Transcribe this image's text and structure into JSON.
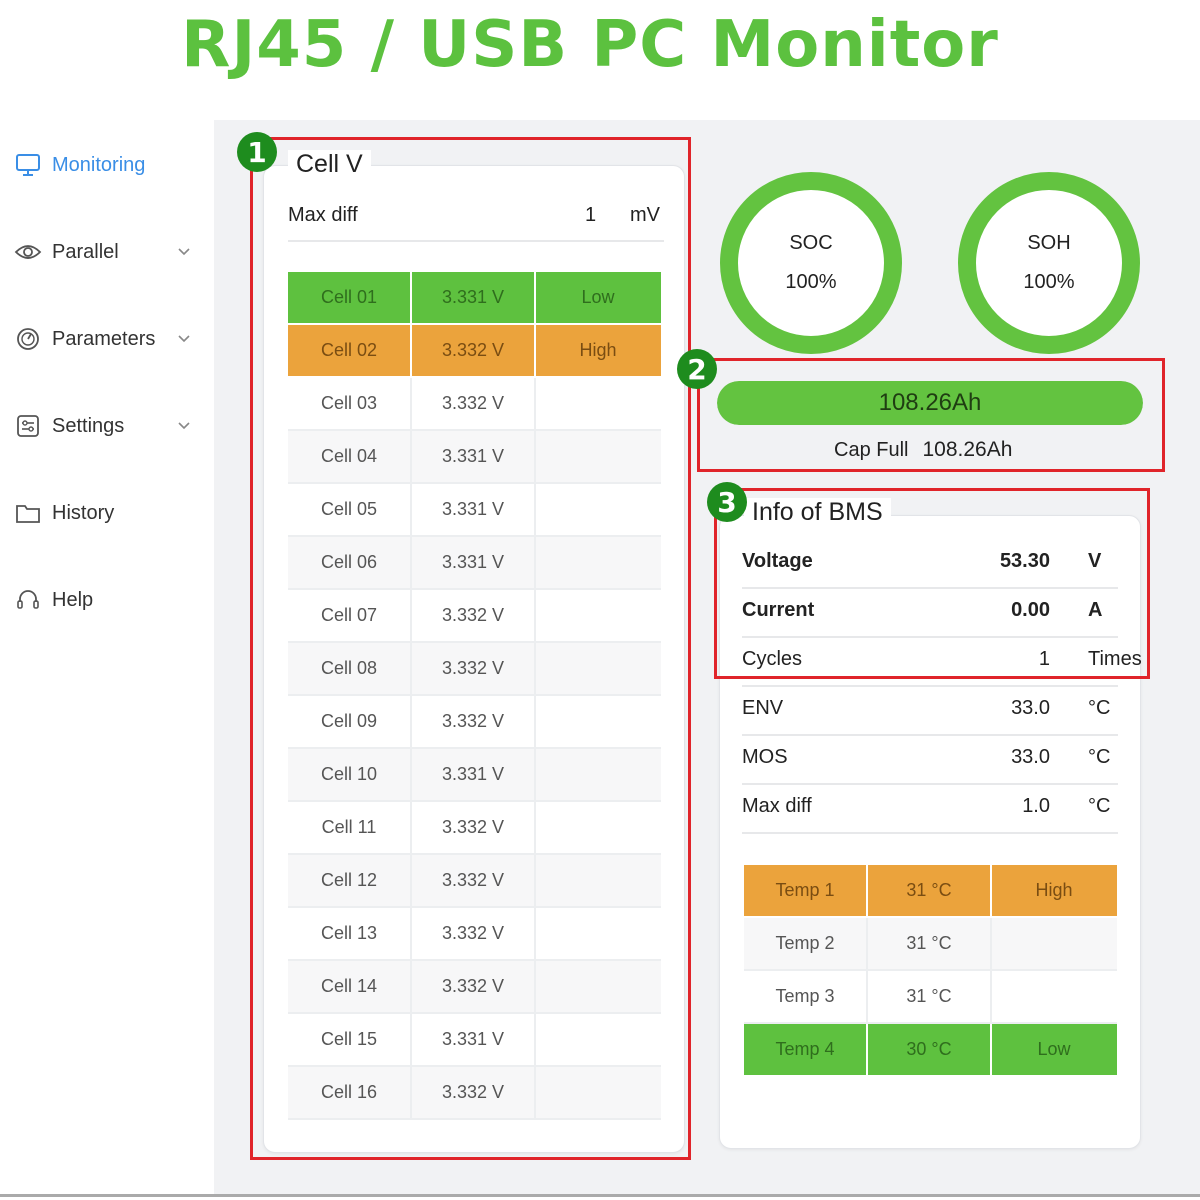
{
  "headline": "RJ45 / USB PC Monitor",
  "colors": {
    "accent_green": "#63c340",
    "warn_orange": "#eba33c",
    "active_blue": "#3a8ee6",
    "annotation_red": "#e0242a"
  },
  "sidebar": {
    "items": [
      {
        "label": "Monitoring",
        "icon": "monitor-icon",
        "active": true,
        "expandable": false
      },
      {
        "label": "Parallel",
        "icon": "eye-icon",
        "active": false,
        "expandable": true
      },
      {
        "label": "Parameters",
        "icon": "gauge-icon",
        "active": false,
        "expandable": true
      },
      {
        "label": "Settings",
        "icon": "sliders-icon",
        "active": false,
        "expandable": true
      },
      {
        "label": "History",
        "icon": "folder-icon",
        "active": false,
        "expandable": false
      },
      {
        "label": "Help",
        "icon": "headset-icon",
        "active": false,
        "expandable": false
      }
    ]
  },
  "cell_card": {
    "title": "Cell V",
    "max_diff": {
      "label": "Max diff",
      "value": "1",
      "unit": "mV"
    },
    "rows": [
      {
        "name": "Cell 01",
        "voltage": "3.331 V",
        "flag": "Low"
      },
      {
        "name": "Cell 02",
        "voltage": "3.332 V",
        "flag": "High"
      },
      {
        "name": "Cell 03",
        "voltage": "3.332 V",
        "flag": ""
      },
      {
        "name": "Cell 04",
        "voltage": "3.331 V",
        "flag": ""
      },
      {
        "name": "Cell 05",
        "voltage": "3.331 V",
        "flag": ""
      },
      {
        "name": "Cell 06",
        "voltage": "3.331 V",
        "flag": ""
      },
      {
        "name": "Cell 07",
        "voltage": "3.332 V",
        "flag": ""
      },
      {
        "name": "Cell 08",
        "voltage": "3.332 V",
        "flag": ""
      },
      {
        "name": "Cell 09",
        "voltage": "3.332 V",
        "flag": ""
      },
      {
        "name": "Cell 10",
        "voltage": "3.331 V",
        "flag": ""
      },
      {
        "name": "Cell 11",
        "voltage": "3.332 V",
        "flag": ""
      },
      {
        "name": "Cell 12",
        "voltage": "3.332 V",
        "flag": ""
      },
      {
        "name": "Cell 13",
        "voltage": "3.332 V",
        "flag": ""
      },
      {
        "name": "Cell 14",
        "voltage": "3.332 V",
        "flag": ""
      },
      {
        "name": "Cell 15",
        "voltage": "3.331 V",
        "flag": ""
      },
      {
        "name": "Cell 16",
        "voltage": "3.332 V",
        "flag": ""
      }
    ]
  },
  "soc": {
    "label": "SOC",
    "value": "100%",
    "percent": 100
  },
  "soh": {
    "label": "SOH",
    "value": "100%",
    "percent": 100
  },
  "capacity": {
    "remaining": "108.26Ah",
    "fill_percent": 100,
    "full_label": "Cap Full",
    "full_value": "108.26Ah"
  },
  "bms": {
    "title": "Info of BMS",
    "rows": [
      {
        "key": "Voltage",
        "value": "53.30",
        "unit": "V",
        "bold": true
      },
      {
        "key": "Current",
        "value": "0.00",
        "unit": "A",
        "bold": true
      },
      {
        "key": "Cycles",
        "value": "1",
        "unit": "Times",
        "bold": false
      },
      {
        "key": "ENV",
        "value": "33.0",
        "unit": "°C",
        "bold": false
      },
      {
        "key": "MOS",
        "value": "33.0",
        "unit": "°C",
        "bold": false
      },
      {
        "key": "Max diff",
        "value": "1.0",
        "unit": "°C",
        "bold": false
      }
    ],
    "temps": [
      {
        "name": "Temp 1",
        "value": "31 °C",
        "flag": "High"
      },
      {
        "name": "Temp 2",
        "value": "31 °C",
        "flag": ""
      },
      {
        "name": "Temp 3",
        "value": "31 °C",
        "flag": ""
      },
      {
        "name": "Temp 4",
        "value": "30 °C",
        "flag": "Low"
      }
    ]
  },
  "annotations": {
    "badge_1": "1",
    "badge_2": "2",
    "badge_3": "3"
  }
}
